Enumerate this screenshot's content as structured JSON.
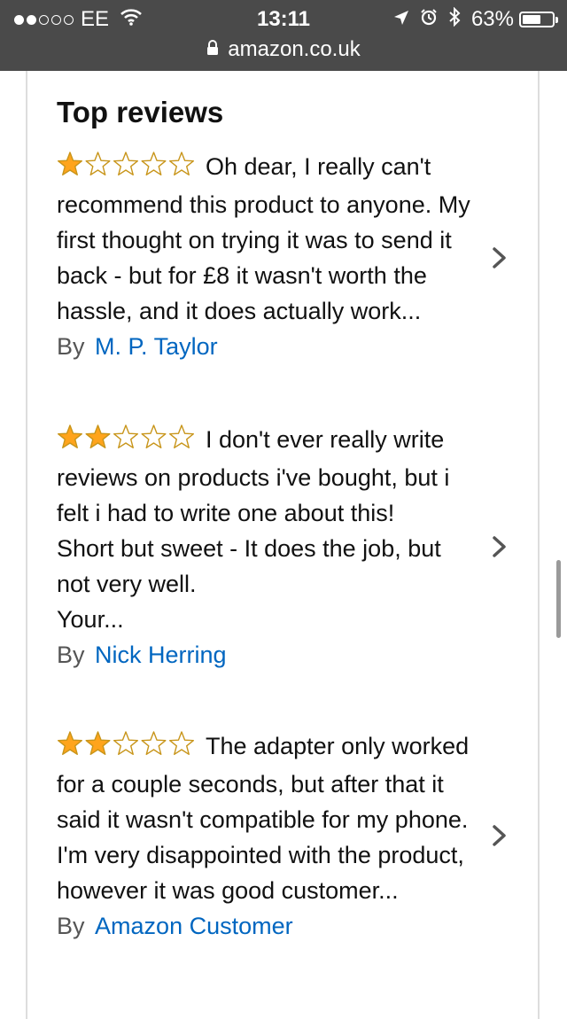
{
  "status_bar": {
    "carrier": "EE",
    "time": "13:11",
    "battery_percent": "63%",
    "battery_level": 0.63,
    "icons": [
      "signal-dots-icon",
      "wifi-icon",
      "location-arrow-icon",
      "alarm-icon",
      "bluetooth-icon",
      "battery-icon"
    ]
  },
  "browser": {
    "url": "amazon.co.uk",
    "lock_icon": "lock-icon"
  },
  "section": {
    "title": "Top reviews"
  },
  "reviews": [
    {
      "rating": 1,
      "text": "Oh dear, I really can't recommend this product to anyone. My first thought on trying it was to send it back - but for £8 it wasn't worth the hassle, and it does actually work...",
      "by_label": "By",
      "author": "M. P. Taylor"
    },
    {
      "rating": 2,
      "text": "I don't ever really write reviews on products i've bought, but i felt i had to write one about this!\nShort but sweet - It does the job, but not very well.\nYour...",
      "by_label": "By",
      "author": "Nick Herring"
    },
    {
      "rating": 2,
      "text": "The adapter only worked for a couple seconds, but after that it said it wasn't compatible for my phone. I'm very disappointed with the product, however it was good customer...",
      "by_label": "By",
      "author": "Amazon Customer"
    }
  ],
  "colors": {
    "status_bg": "#4a4a4a",
    "star_fill": "#ffa41c",
    "star_outline": "#c8951a",
    "link": "#0066c0"
  }
}
